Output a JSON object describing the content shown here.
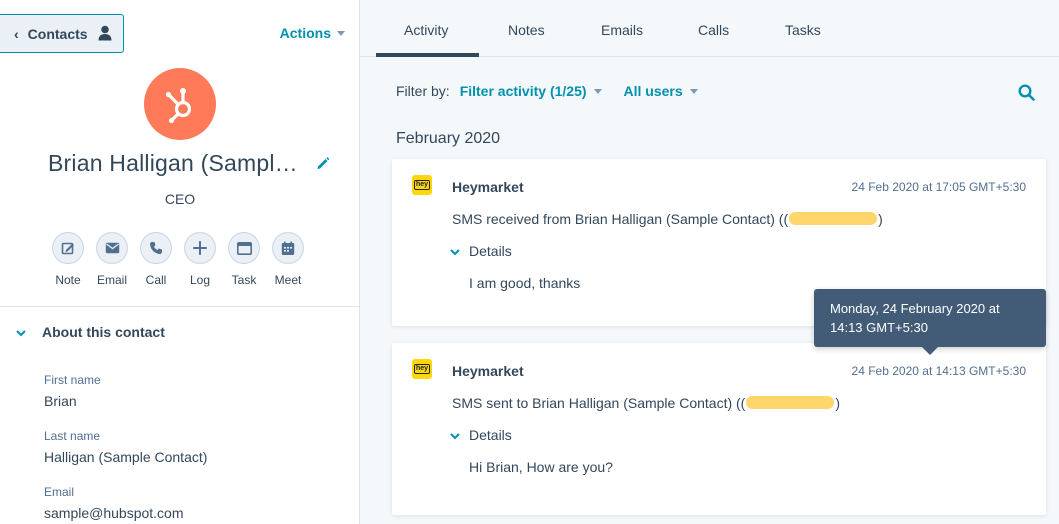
{
  "sidebar": {
    "back_label": "Contacts",
    "actions_label": "Actions",
    "contact_name": "Brian Halligan (Sample Contact)",
    "job_title": "CEO",
    "quick_actions": [
      {
        "label": "Note",
        "icon": "note-icon"
      },
      {
        "label": "Email",
        "icon": "email-icon"
      },
      {
        "label": "Call",
        "icon": "call-icon"
      },
      {
        "label": "Log",
        "icon": "plus-icon"
      },
      {
        "label": "Task",
        "icon": "task-icon"
      },
      {
        "label": "Meet",
        "icon": "calendar-icon"
      }
    ],
    "about_title": "About this contact",
    "properties": [
      {
        "label": "First name",
        "value": "Brian"
      },
      {
        "label": "Last name",
        "value": "Halligan (Sample Contact)"
      },
      {
        "label": "Email",
        "value": "sample@hubspot.com"
      }
    ]
  },
  "tabs": [
    "Activity",
    "Notes",
    "Emails",
    "Calls",
    "Tasks"
  ],
  "active_tab": "Activity",
  "filter": {
    "label": "Filter by:",
    "activity_filter": "Filter activity (1/25)",
    "users_filter": "All users"
  },
  "month_header": "February 2020",
  "activities": [
    {
      "source": "Heymarket",
      "logo_text": "hey",
      "timestamp": "24 Feb 2020 at 17:05 GMT+5:30",
      "summary_prefix": "SMS received from Brian Halligan (Sample Contact) ((",
      "summary_suffix": ")",
      "details_label": "Details",
      "message": "I am good, thanks"
    },
    {
      "source": "Heymarket",
      "logo_text": "hey",
      "timestamp": "24 Feb 2020 at 14:13 GMT+5:30",
      "summary_prefix": "SMS sent to Brian Halligan (Sample Contact) ((",
      "summary_suffix": ")",
      "details_label": "Details",
      "message": "Hi Brian, How are you?"
    }
  ],
  "tooltip": {
    "line1": "Monday, 24 February 2020 at",
    "line2": "14:13 GMT+5:30"
  },
  "colors": {
    "accent": "#0091ae",
    "text": "#33475b",
    "avatar": "#ff7a59",
    "tooltip_bg": "#425b76",
    "heymarket_logo": "#ffd60a",
    "redaction": "#ffd66b"
  }
}
